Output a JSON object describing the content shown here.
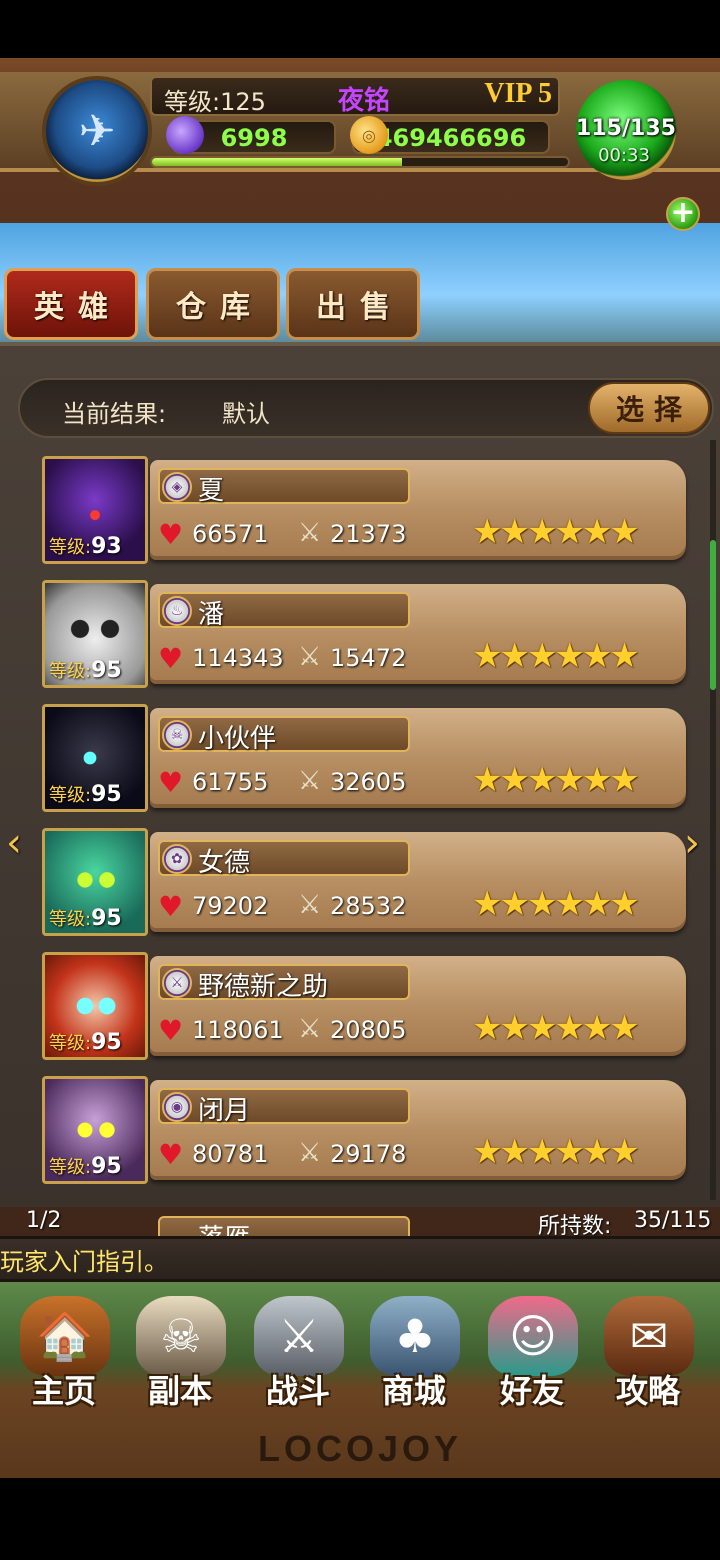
{
  "player": {
    "level_label": "等级:125",
    "name": "夜铭",
    "vip": "VIP 5",
    "gems": "6998",
    "gold": "469466696",
    "stamina": "115/135",
    "stamina_timer": "00:33",
    "exp_progress": 0.6
  },
  "tabs": [
    {
      "label": "英雄",
      "active": true
    },
    {
      "label": "仓库",
      "active": false
    },
    {
      "label": "出售",
      "active": false
    }
  ],
  "filter": {
    "label": "当前结果:",
    "value": "默认",
    "select_label": "选择"
  },
  "heroes": [
    {
      "name": "夏",
      "level_label": "等级:",
      "level": "93",
      "hp": "66571",
      "atk": "21373",
      "stars": 6,
      "icon": "shield-icon"
    },
    {
      "name": "潘",
      "level_label": "等级:",
      "level": "95",
      "hp": "114343",
      "atk": "15472",
      "stars": 6,
      "icon": "flame-icon"
    },
    {
      "name": "小伙伴",
      "level_label": "等级:",
      "level": "95",
      "hp": "61755",
      "atk": "32605",
      "stars": 6,
      "icon": "skull-icon"
    },
    {
      "name": "女德",
      "level_label": "等级:",
      "level": "95",
      "hp": "79202",
      "atk": "28532",
      "stars": 6,
      "icon": "paw-icon"
    },
    {
      "name": "野德新之助",
      "level_label": "等级:",
      "level": "95",
      "hp": "118061",
      "atk": "20805",
      "stars": 6,
      "icon": "sword-class-icon"
    },
    {
      "name": "闭月",
      "level_label": "等级:",
      "level": "95",
      "hp": "80781",
      "atk": "29178",
      "stars": 6,
      "icon": "eye-icon"
    }
  ],
  "partial_hero_name": "落雁",
  "page_indicator": "1/2",
  "owned_label": "所持数:",
  "owned_value": "35/115",
  "ticker": "玩家入门指引。",
  "nav": [
    {
      "label": "主页",
      "icon": "house-icon"
    },
    {
      "label": "副本",
      "icon": "skull-helmet-icon"
    },
    {
      "label": "战斗",
      "icon": "battle-axe-icon"
    },
    {
      "label": "商城",
      "icon": "shop-monster-icon"
    },
    {
      "label": "好友",
      "icon": "friends-icon"
    },
    {
      "label": "攻略",
      "icon": "guide-book-icon"
    }
  ],
  "logo": "LOCOJOY"
}
